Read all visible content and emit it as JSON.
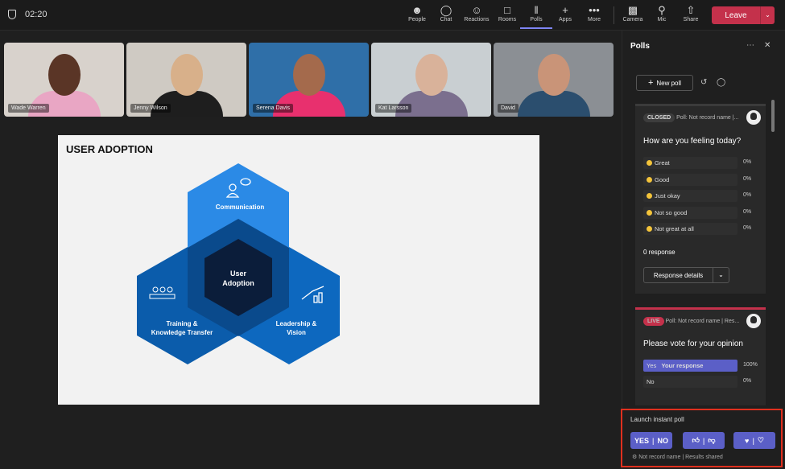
{
  "topbar": {
    "timer": "02:20",
    "tools": [
      {
        "label": "People",
        "icon": "people-icon"
      },
      {
        "label": "Chat",
        "icon": "chat-icon"
      },
      {
        "label": "Reactions",
        "icon": "reactions-icon"
      },
      {
        "label": "Rooms",
        "icon": "rooms-icon"
      },
      {
        "label": "Polls",
        "icon": "polls-icon",
        "active": true
      },
      {
        "label": "Apps",
        "icon": "plus-icon"
      },
      {
        "label": "More",
        "icon": "more-icon"
      },
      {
        "label": "Camera",
        "icon": "camera-off-icon"
      },
      {
        "label": "Mic",
        "icon": "mic-off-icon"
      },
      {
        "label": "Share",
        "icon": "share-icon"
      }
    ],
    "leave": "Leave"
  },
  "participants": [
    {
      "name": "Wade Warren"
    },
    {
      "name": "Jenny Wilson"
    },
    {
      "name": "Serena Davis"
    },
    {
      "name": "Kat Larsson"
    },
    {
      "name": "David"
    }
  ],
  "slide": {
    "title": "USER ADOPTION",
    "center": [
      "User",
      "Adoption"
    ],
    "communication": "Communication",
    "training": [
      "Training &",
      "Knowledge Transfer"
    ],
    "leadership": [
      "Leadership &",
      "Vision"
    ]
  },
  "panel": {
    "title": "Polls",
    "new_poll": "New poll",
    "poll1": {
      "status": "CLOSED",
      "meta": "Poll: Not record name |...",
      "question": "How are you feeling today?",
      "options": [
        {
          "label": "Great",
          "pct": "0%"
        },
        {
          "label": "Good",
          "pct": "0%"
        },
        {
          "label": "Just okay",
          "pct": "0%"
        },
        {
          "label": "Not so good",
          "pct": "0%"
        },
        {
          "label": "Not great at all",
          "pct": "0%"
        }
      ],
      "responses": "0 response",
      "details": "Response details"
    },
    "poll2": {
      "status": "LIVE",
      "meta": "Poll: Not record name | Res...",
      "question": "Please vote for your opinion",
      "options": [
        {
          "label": "Yes",
          "tag": "Your response",
          "pct": "100%"
        },
        {
          "label": "No",
          "pct": "0%"
        }
      ]
    },
    "launch": {
      "title": "Launch instant poll",
      "yes": "YES",
      "no": "NO",
      "settings": "Not record name | Results shared"
    }
  },
  "colors": {
    "accent": "#5b5fc7",
    "leave": "#c4314b",
    "live": "#c4314b",
    "highlight": "#e0301e"
  }
}
